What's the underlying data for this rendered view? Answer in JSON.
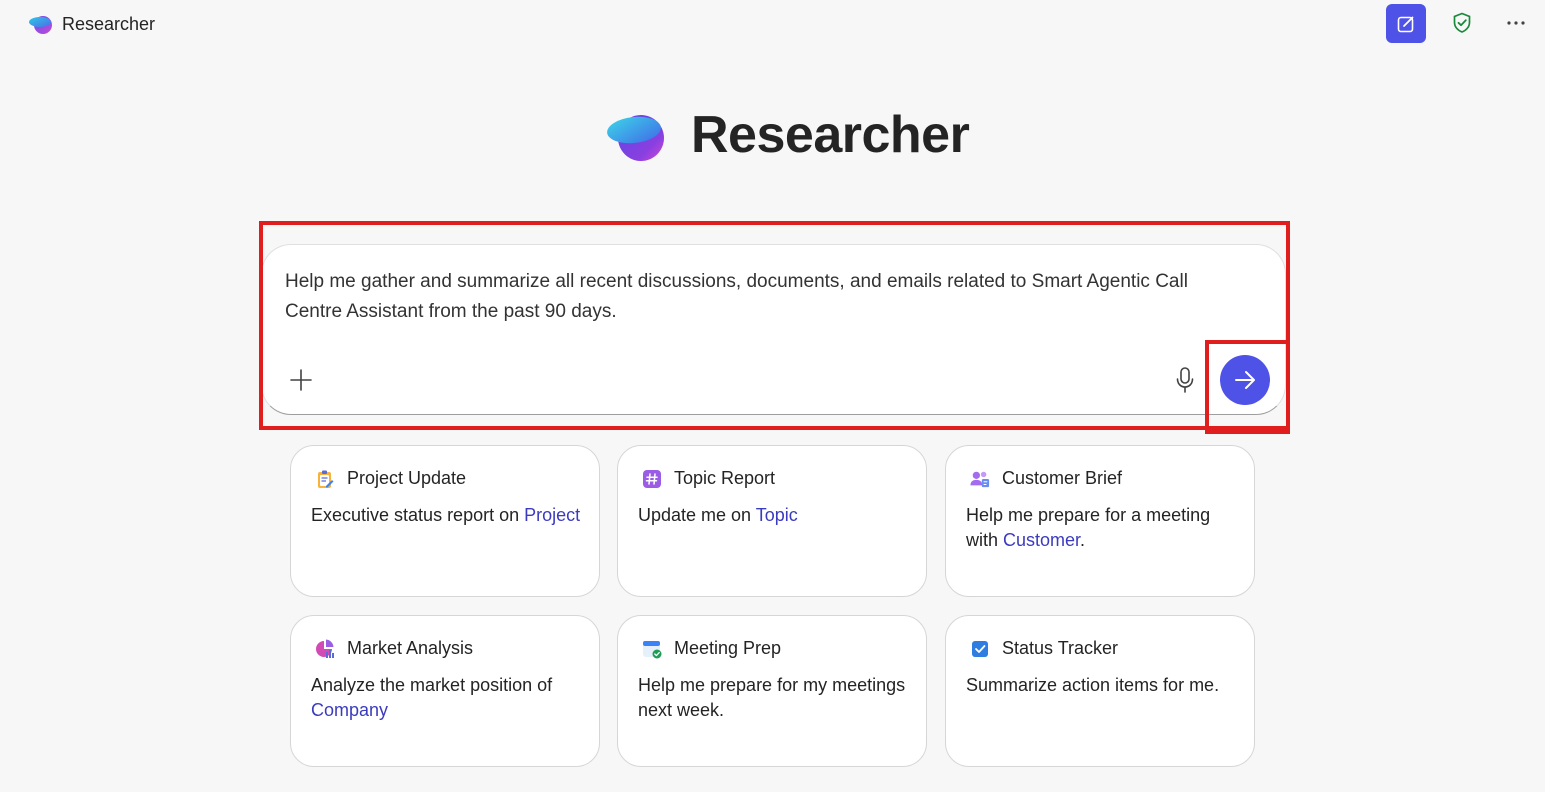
{
  "app": {
    "name": "Researcher"
  },
  "hero": {
    "title": "Researcher"
  },
  "composer": {
    "prompt": "Help me gather and summarize all recent discussions, documents, and emails related to Smart Agentic Call Centre Assistant from the past 90 days."
  },
  "cards": [
    {
      "title": "Project Update",
      "desc_before": "Executive status report on ",
      "desc_link": "Project",
      "desc_after": "",
      "icon": "clipboard-icon"
    },
    {
      "title": "Topic Report",
      "desc_before": "Update me on ",
      "desc_link": "Topic",
      "desc_after": "",
      "icon": "hashtag-icon"
    },
    {
      "title": "Customer Brief",
      "desc_before": "Help me prepare for a meeting with ",
      "desc_link": "Customer",
      "desc_after": ".",
      "icon": "people-icon"
    },
    {
      "title": "Market Analysis",
      "desc_before": "Analyze the market position of ",
      "desc_link": "Company",
      "desc_after": "",
      "icon": "pie-chart-icon"
    },
    {
      "title": "Meeting Prep",
      "desc_before": "Help me prepare for my meetings next week.",
      "desc_link": "",
      "desc_after": "",
      "icon": "calendar-check-icon"
    },
    {
      "title": "Status Tracker",
      "desc_before": "Summarize action items for me.",
      "desc_link": "",
      "desc_after": "",
      "icon": "checkbox-icon"
    }
  ],
  "colors": {
    "accent": "#4f52e6",
    "link": "#3b3bbf",
    "highlight": "#e01e1e"
  }
}
